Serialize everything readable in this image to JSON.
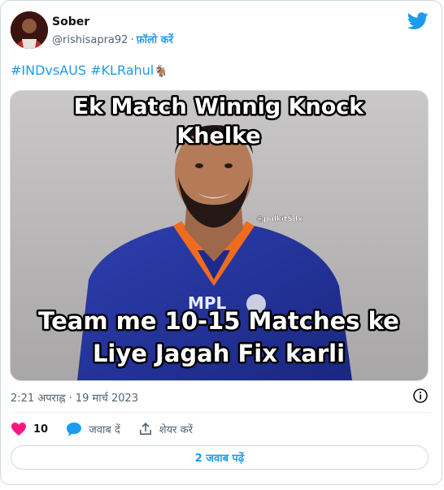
{
  "author": {
    "display_name": "Sober",
    "handle": "@rishisapra92",
    "separator": "·",
    "follow_label": "फ़ॉलो करें"
  },
  "tweet": {
    "hashtags": [
      "#INDvsAUS",
      "#KLRahul"
    ],
    "hashtag_emoji": "🐐"
  },
  "media": {
    "caption_top": [
      "Ek Match Winnig Knock",
      "Khelke"
    ],
    "caption_bottom": [
      "Team me 10-15 Matches ke",
      "Liye Jagah Fix karli"
    ],
    "watermark": "@pulkitSdx",
    "jersey_text": "MPL"
  },
  "meta": {
    "timestamp": "2:21 अपराह्न · 19 मार्च 2023"
  },
  "actions": {
    "like_count": "10",
    "reply_label": "जवाब दें",
    "share_label": "शेयर करें"
  },
  "replies_button_label": "2 जवाब पढ़ें",
  "colors": {
    "accent": "#1d9bf0",
    "like": "#f91880",
    "muted": "#536471"
  }
}
